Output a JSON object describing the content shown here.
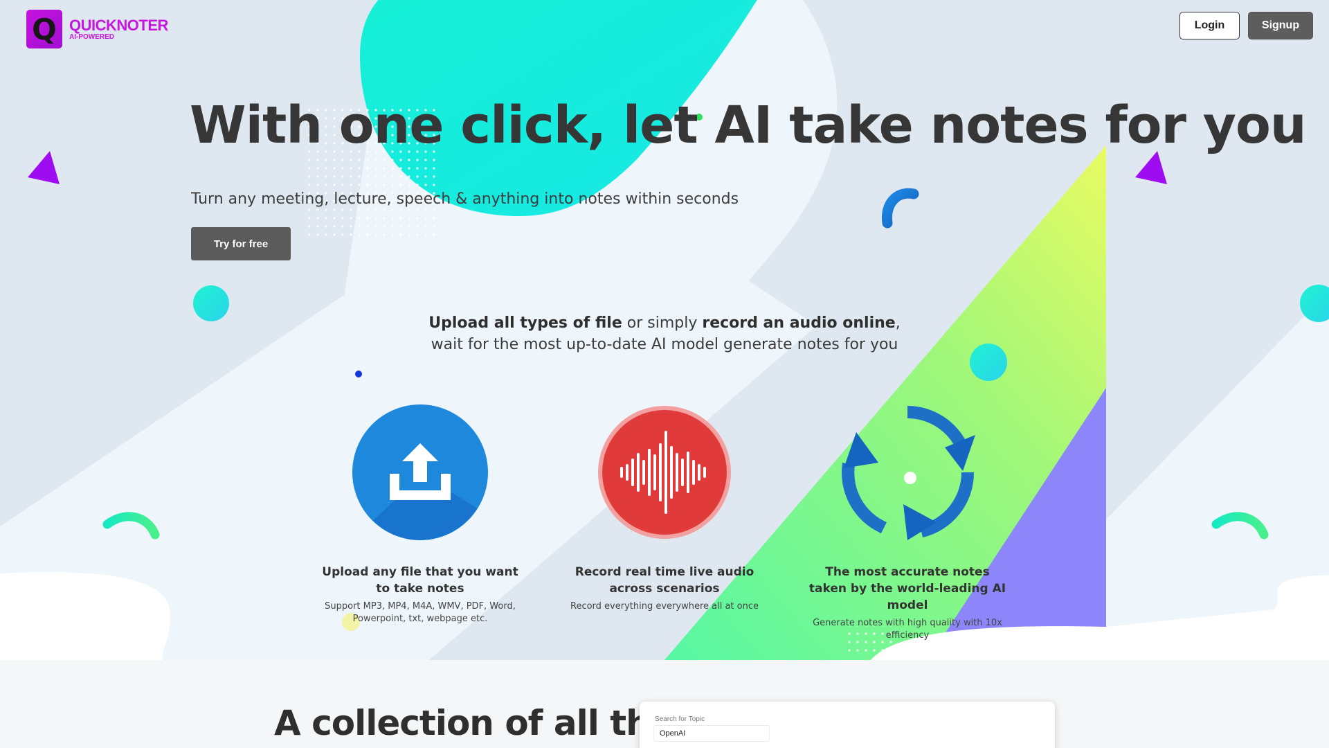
{
  "brand": {
    "name": "QUICKNOTER",
    "tagline": "AI-POWERED",
    "mark": "Q",
    "color": "#c516e2"
  },
  "nav": {
    "login_label": "Login",
    "signup_label": "Signup"
  },
  "hero": {
    "title": "With one click, let AI take notes for you",
    "subtitle": "Turn any meeting, lecture, speech & anything into notes within seconds",
    "cta_label": "Try for free"
  },
  "intro": {
    "bold1": "Upload all types of file",
    "text1": " or simply ",
    "bold2": "record an audio online",
    "text2": ",",
    "line2": "wait for the most up-to-date AI model generate notes for you"
  },
  "features": [
    {
      "icon": "upload-icon",
      "title": "Upload any file that you want to take notes",
      "desc": "Support MP3, MP4, M4A, WMV, PDF, Word, Powerpoint, txt, webpage etc."
    },
    {
      "icon": "audio-wave-icon",
      "title": "Record real time live audio across scenarios",
      "desc": "Record everything everywhere all at once"
    },
    {
      "icon": "refresh-cycle-icon",
      "title": "The most accurate notes taken by the world-leading AI model",
      "desc": "Generate notes  with high quality with 10x efficiency"
    }
  ],
  "section2": {
    "title": "A collection of all the",
    "search_label": "Search for Topic",
    "search_value": "OpenAI"
  },
  "colors": {
    "accent_blue": "#1e88dd",
    "accent_red": "#e23b3b",
    "cta_bg": "#5b5b5b"
  }
}
